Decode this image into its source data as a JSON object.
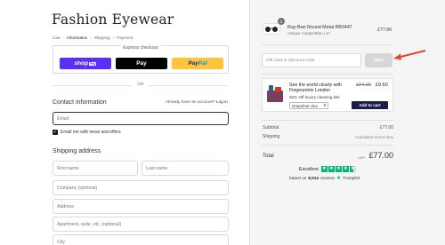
{
  "brand": "Fashion Eyewear",
  "breadcrumbs": [
    "Cart",
    "Information",
    "Shipping",
    "Payment"
  ],
  "breadcrumb_sep": "›",
  "express": {
    "title": "Express checkout",
    "shop_pay": "shop",
    "shop_pay_tag": "Pay",
    "apple_pay": "Pay",
    "apple_pay_symbol": "",
    "paypal_pay": "Pay",
    "paypal_pal": "Pal"
  },
  "or_text": "OR",
  "contact": {
    "title": "Contact information",
    "login_prompt": "Already have an account?",
    "login_link": "Log in",
    "email_placeholder": "Email",
    "newsletter_label": "Email me with news and offers"
  },
  "shipping": {
    "title": "Shipping address",
    "first_name": "First name",
    "last_name": "Last name",
    "company": "Company (optional)",
    "address": "Address",
    "apartment": "Apartment, suite, etc. (optional)",
    "city": "City"
  },
  "cart": {
    "product_name": "Ray-Ban Round Metal RB3447",
    "product_variant": "Antique Copper/Blue | 47",
    "product_price": "£77.00",
    "quantity": "1",
    "discount_placeholder": "Gift card or discount code",
    "apply_label": "Apply"
  },
  "upsell": {
    "title": "See the world clearly with Fingerprints London",
    "subtitle": "60% Off luxury cleaning kits",
    "old_price": "£24.00",
    "new_price": "£9.60",
    "select_value": "Grapefruit clea",
    "add_label": "Add to cart"
  },
  "summary": {
    "subtotal_label": "Subtotal",
    "subtotal_value": "£77.00",
    "shipping_label": "Shipping",
    "shipping_value": "Calculated at next step",
    "total_label": "Total",
    "currency": "GBP",
    "total_value": "£77.00"
  },
  "trustpilot": {
    "rating_word": "Excellent",
    "based_on": "based on",
    "review_count": "8,514",
    "reviews_word": "reviews",
    "brand": "Trustpilot"
  },
  "colors": {
    "shop_pay": "#5a31f4",
    "paypal": "#ffc439",
    "trustpilot_green": "#00b67a",
    "add_to_cart": "#1c1c46",
    "arrow": "#e8452c"
  }
}
